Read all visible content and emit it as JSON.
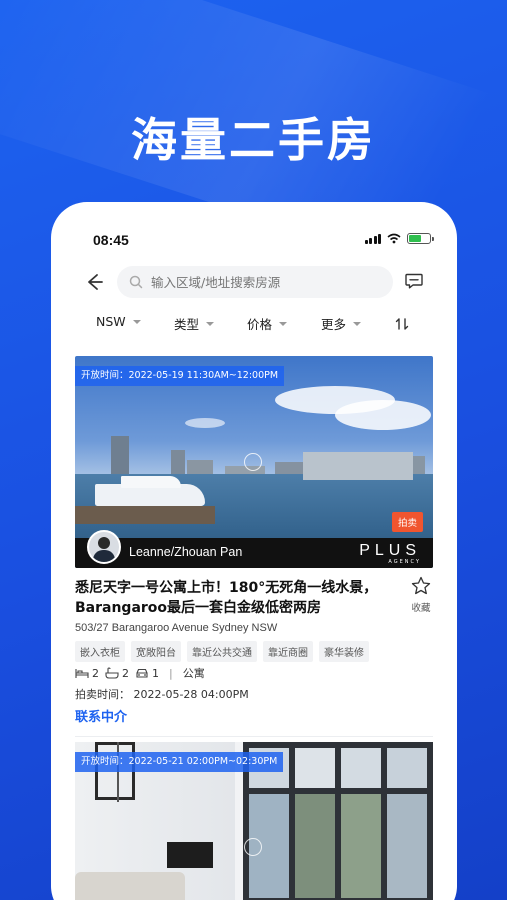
{
  "hero": {
    "headline": "海量二手房"
  },
  "status_bar": {
    "time": "08:45"
  },
  "search": {
    "placeholder": "输入区域/地址搜索房源"
  },
  "filters": [
    {
      "label": "NSW"
    },
    {
      "label": "类型"
    },
    {
      "label": "价格"
    },
    {
      "label": "更多"
    }
  ],
  "listings": [
    {
      "open_time": "开放时间：2022-05-19 11:30AM~12:00PM",
      "auction_badge": "拍卖",
      "agent_name": "Leanne/Zhouan Pan",
      "agency_name": "PLUS",
      "agency_sub": "AGENCY",
      "title": "悉尼天字一号公寓上市！180°无死角一线水景，Barangaroo最后一套白金级低密两房",
      "favorite_label": "收藏",
      "address": "503/27 Barangaroo Avenue Sydney NSW",
      "tags": [
        "嵌入衣柜",
        "宽敞阳台",
        "靠近公共交通",
        "靠近商圈",
        "豪华装修"
      ],
      "bedrooms": "2",
      "bathrooms": "2",
      "parking": "1",
      "property_type": "公寓",
      "auction_time": "拍卖时间：  2022-05-28 04:00PM",
      "contact_label": "联系中介"
    },
    {
      "open_time": "开放时间：2022-05-21 02:00PM~02:30PM"
    }
  ],
  "colors": {
    "accent": "#1e63f0",
    "auction": "#f0552f",
    "background": "#1a4fe0"
  }
}
